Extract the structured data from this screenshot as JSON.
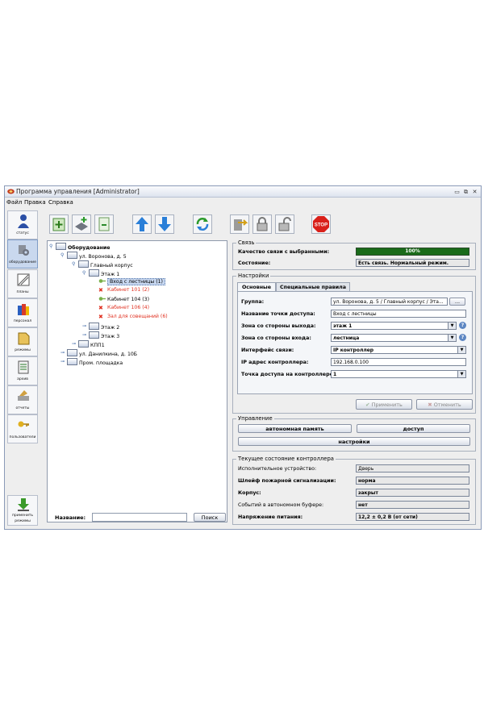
{
  "window": {
    "title": "Программа управления [Administrator]"
  },
  "menu": [
    "Файл",
    "Правка",
    "Справка"
  ],
  "sidebar": {
    "items": [
      {
        "label": "статус",
        "icon": "person-icon"
      },
      {
        "label": "оборудование",
        "icon": "equipment-icon"
      },
      {
        "label": "планы",
        "icon": "plans-icon"
      },
      {
        "label": "персонал",
        "icon": "staff-icon"
      },
      {
        "label": "режимы",
        "icon": "modes-icon"
      },
      {
        "label": "архив",
        "icon": "archive-icon"
      },
      {
        "label": "отчеты",
        "icon": "reports-icon"
      },
      {
        "label": "пользователи",
        "icon": "keys-icon"
      }
    ],
    "apply": {
      "label1": "применить",
      "label2": "режимы"
    }
  },
  "tree": {
    "root": "Оборудование",
    "n1": "ул. Воронова, д. 5",
    "n2": "Главный корпус",
    "n3": "Этаж 1",
    "n4": "Вход с лестницы (1)",
    "n5": "Кабинет 101 (2)",
    "n6": "Кабинет 104 (3)",
    "n7": "Кабинет 106 (4)",
    "n8": "Зал для совещаний (6)",
    "n9": "Этаж 2",
    "n10": "Этаж 3",
    "n11": "КПП1",
    "n12": "ул. Данилкина, д. 10Б",
    "n13": "Пром. площадка"
  },
  "search": {
    "label": "Название:",
    "value": "",
    "button": "Поиск"
  },
  "link": {
    "title": "Связь",
    "quality_label": "Качество связи с выбранными:",
    "quality_value": "100%",
    "quality_fraction": 1.0,
    "state_label": "Состояние:",
    "state_value": "Есть связь. Нормальный режим."
  },
  "settings": {
    "title": "Настройки",
    "tabs": [
      "Основные",
      "Специальные правила"
    ],
    "group_label": "Группа:",
    "group_value": "ул. Воронова, д. 5 / Главный корпус / Эта...",
    "group_button": "...",
    "name_label": "Название точки доступа:",
    "name_value": "Вход с лестницы",
    "zone_out_label": "Зона со стороны выхода:",
    "zone_out_value": "этаж 1",
    "zone_in_label": "Зона со стороны входа:",
    "zone_in_value": "лестница",
    "iface_label": "Интерфейс связи:",
    "iface_value": "IP контроллер",
    "ip_label": "IP адрес контроллера:",
    "ip_value": "192.168.0.100",
    "point_label": "Точка доступа на контроллере:",
    "point_value": "1",
    "apply_button": "Применить",
    "cancel_button": "Отменить"
  },
  "control": {
    "title": "Управление",
    "mem_button": "автономная память",
    "access_button": "доступ",
    "settings_button": "настройки"
  },
  "state": {
    "title": "Текущее состояние контроллера",
    "dev_label": "Исполнительное устройство:",
    "dev_value": "Дверь",
    "fire_label": "Шлейф пожарной сигнализации:",
    "fire_value": "норма",
    "body_label": "Корпус:",
    "body_value": "закрыт",
    "buffer_label": "Событий в автономном буфере:",
    "buffer_value": "нет",
    "power_label": "Напряжение питания:",
    "power_value": "12,2 ± 0,2 В (от сети)"
  },
  "colors": {
    "accent": "#1a6b1a",
    "selection": "#c7d7f0",
    "error": "#e03020"
  }
}
